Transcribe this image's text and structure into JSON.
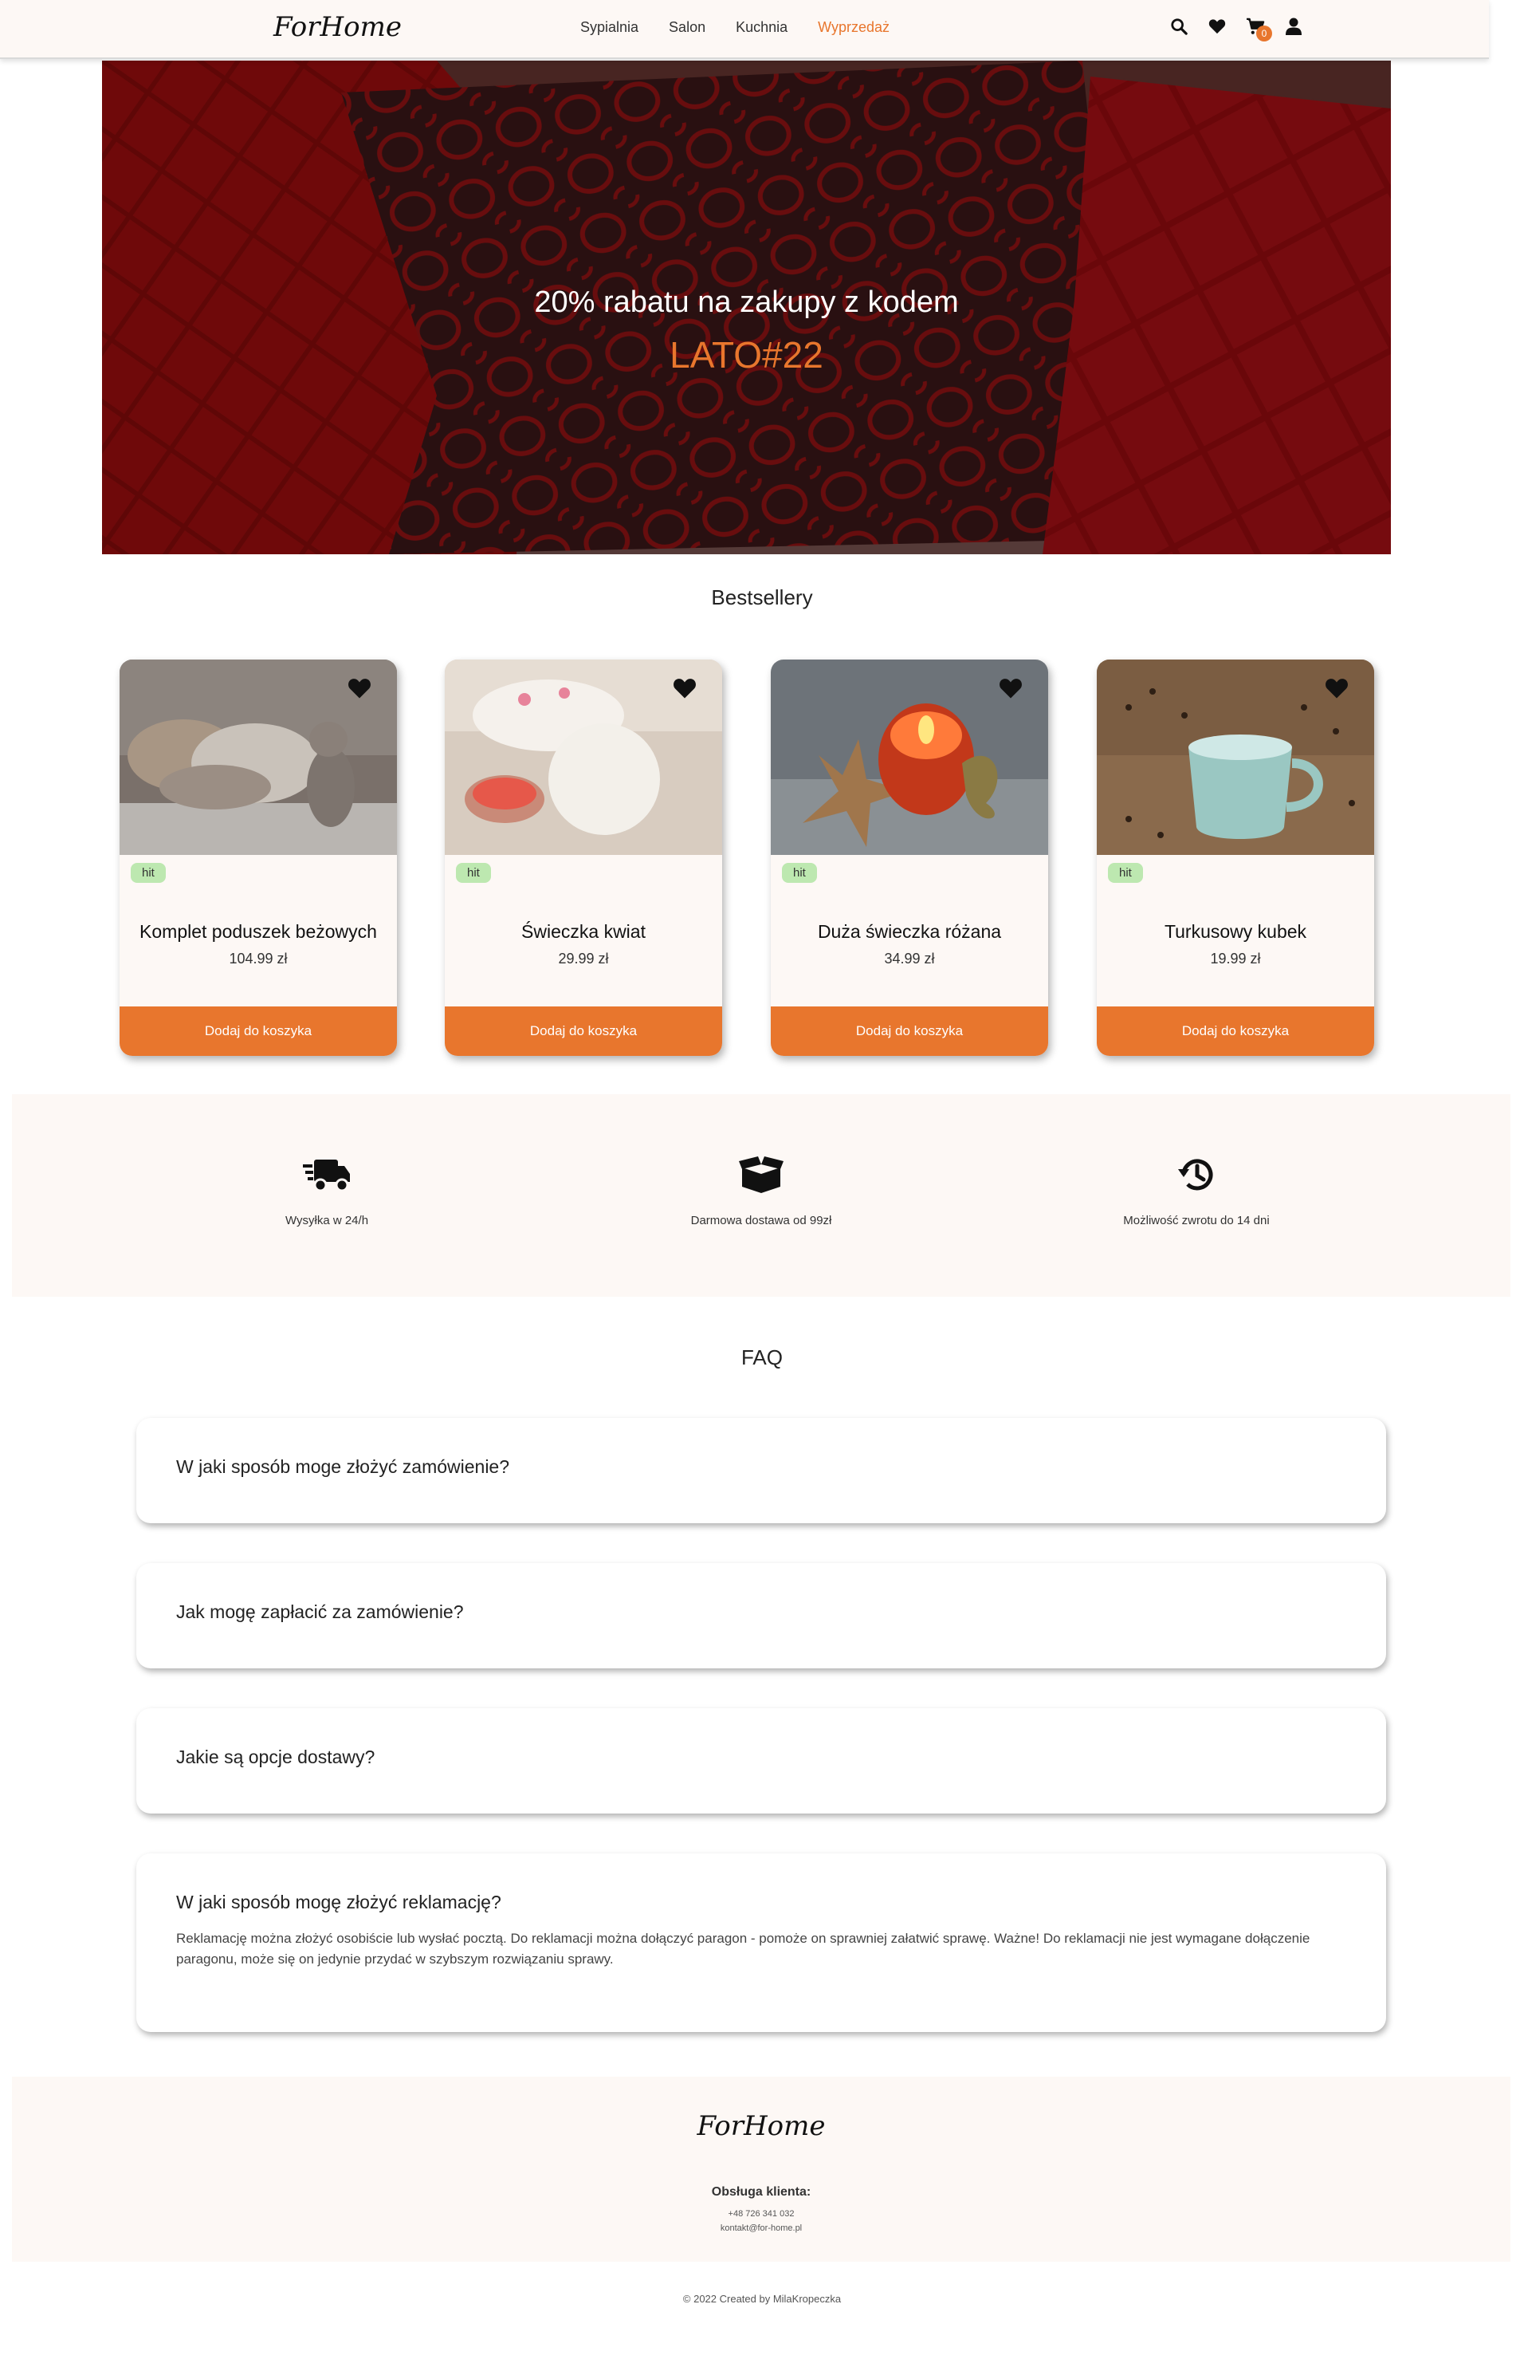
{
  "header": {
    "logo": "ForHome",
    "nav": [
      "Sypialnia",
      "Salon",
      "Kuchnia",
      "Wyprzedaż"
    ],
    "active_nav": "Wyprzedaż",
    "cart_count": "0",
    "icons": [
      "search-icon",
      "heart-icon",
      "cart-icon",
      "user-icon"
    ]
  },
  "hero": {
    "title": "20% rabatu na zakupy z kodem",
    "code": "LATO#22"
  },
  "bestsellers": {
    "title": "Bestsellery",
    "products": [
      {
        "badge": "hit",
        "name": "Komplet poduszek beżowych",
        "price": "104.99 zł",
        "button": "Dodaj do koszyka"
      },
      {
        "badge": "hit",
        "name": "Świeczka kwiat",
        "price": "29.99 zł",
        "button": "Dodaj do koszyka"
      },
      {
        "badge": "hit",
        "name": "Duża świeczka różana",
        "price": "34.99 zł",
        "button": "Dodaj do koszyka"
      },
      {
        "badge": "hit",
        "name": "Turkusowy kubek",
        "price": "19.99 zł",
        "button": "Dodaj do koszyka"
      }
    ]
  },
  "features": [
    {
      "icon": "truck-icon",
      "label": "Wysyłka w 24/h"
    },
    {
      "icon": "box-icon",
      "label": "Darmowa dostawa od 99zł"
    },
    {
      "icon": "history-icon",
      "label": "Możliwość zwrotu do 14 dni"
    }
  ],
  "faq": {
    "title": "FAQ",
    "items": [
      {
        "question": "W jaki sposób moge złożyć zamówienie?",
        "answer": ""
      },
      {
        "question": "Jak mogę zapłacić za zamówienie?",
        "answer": ""
      },
      {
        "question": "Jakie są opcje dostawy?",
        "answer": ""
      },
      {
        "question": "W jaki sposób mogę złożyć reklamację?",
        "answer": "Reklamację można złożyć osobiście lub wysłać pocztą. Do reklamacji można dołączyć paragon - pomoże on sprawniej załatwić sprawę. Ważne! Do reklamacji nie jest wymagane dołączenie paragonu, może się on jedynie przydać w szybszym rozwiązaniu sprawy."
      }
    ]
  },
  "footer": {
    "logo": "ForHome",
    "support_heading": "Obsługa klienta:",
    "phone": "+48 726 341 032",
    "email": "kontakt@for-home.pl",
    "copyright": "© 2022 Created by MilaKropeczka"
  },
  "colors": {
    "accent": "#e8762d",
    "cream": "#fdf8f5",
    "badge_green": "#bde8b0"
  }
}
